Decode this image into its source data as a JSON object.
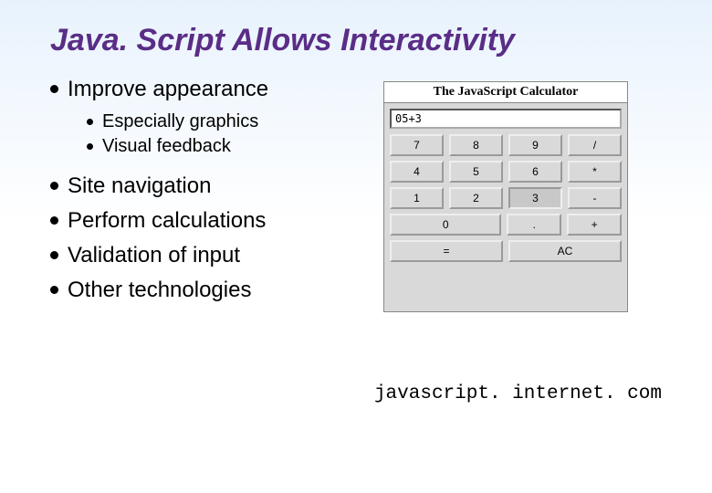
{
  "title": "Java. Script Allows Interactivity",
  "bullets": {
    "b1": "Improve appearance",
    "sub1": "Especially graphics",
    "sub2": "Visual feedback",
    "b2": "Site navigation",
    "b3": "Perform calculations",
    "b4": "Validation of input",
    "b5": "Other technologies"
  },
  "calc": {
    "title": "The JavaScript Calculator",
    "display": "05+3",
    "keys": {
      "k7": "7",
      "k8": "8",
      "k9": "9",
      "kdiv": "/",
      "k4": "4",
      "k5": "5",
      "k6": "6",
      "kmul": "*",
      "k1": "1",
      "k2": "2",
      "k3": "3",
      "kmin": "-",
      "k0": "0",
      "kdot": ".",
      "kplus": "+",
      "keq": "=",
      "kac": "AC"
    }
  },
  "caption": "javascript. internet. com"
}
